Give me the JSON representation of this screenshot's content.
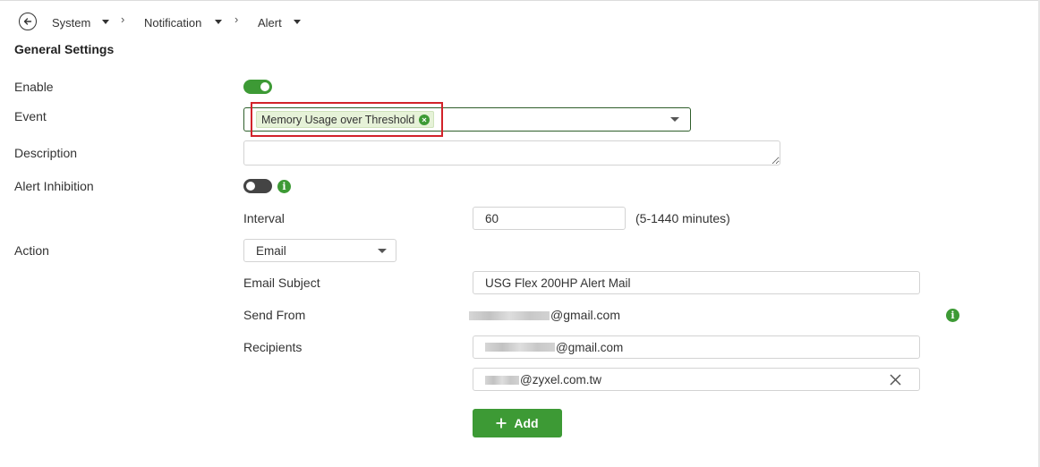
{
  "breadcrumb": {
    "items": [
      "System",
      "Notification",
      "Alert"
    ]
  },
  "page": {
    "section_title": "General Settings"
  },
  "labels": {
    "enable": "Enable",
    "event": "Event",
    "description": "Description",
    "alert_inhibition": "Alert Inhibition",
    "interval": "Interval",
    "action": "Action",
    "email_subject": "Email Subject",
    "send_from": "Send From",
    "recipients": "Recipients"
  },
  "form": {
    "enable": true,
    "event_selected": "Memory Usage over Threshold",
    "description_value": "",
    "alert_inhibition": false,
    "interval_value": "60",
    "interval_hint": "(5-1440 minutes)",
    "action_value": "Email",
    "email_subject_value": "USG Flex 200HP Alert Mail",
    "send_from_domain": "@gmail.com",
    "recipients": [
      {
        "domain": "@gmail.com"
      },
      {
        "domain": "@zyxel.com.tw"
      }
    ],
    "add_label": "Add"
  },
  "colors": {
    "accent": "#3d9a35",
    "highlight": "#d2232a"
  },
  "icons": [
    "back-arrow-icon",
    "caret-down-icon",
    "chevron-right-icon",
    "close-icon",
    "info-icon",
    "plus-icon"
  ]
}
